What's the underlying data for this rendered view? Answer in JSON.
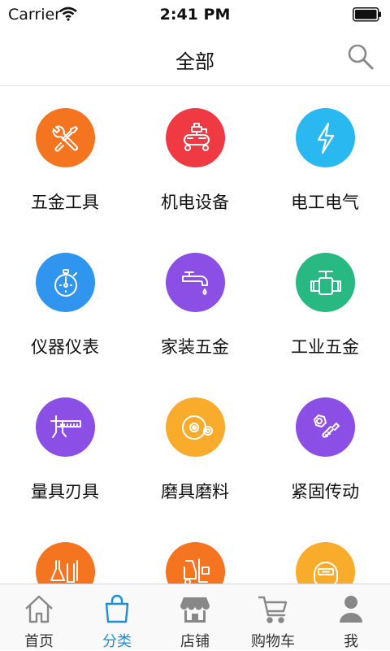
{
  "status_bar": {
    "carrier": "Carrier",
    "time": "2:41 PM"
  },
  "header": {
    "title": "全部"
  },
  "categories": [
    {
      "label": "五金工具",
      "icon": "wrench-screwdriver-icon",
      "color": "#f47420"
    },
    {
      "label": "机电设备",
      "icon": "air-compressor-icon",
      "color": "#ef3a44"
    },
    {
      "label": "电工电气",
      "icon": "lightning-bolt-icon",
      "color": "#2ab8f0"
    },
    {
      "label": "仪器仪表",
      "icon": "stopwatch-icon",
      "color": "#2f95ee"
    },
    {
      "label": "家装五金",
      "icon": "faucet-icon",
      "color": "#8c4fe6"
    },
    {
      "label": "工业五金",
      "icon": "valve-icon",
      "color": "#28b983"
    },
    {
      "label": "量具刃具",
      "icon": "caliper-icon",
      "color": "#8c4fe6"
    },
    {
      "label": "磨具磨料",
      "icon": "grinding-disc-icon",
      "color": "#f9ab2c"
    },
    {
      "label": "紧固传动",
      "icon": "bolt-nut-icon",
      "color": "#8c4fe6"
    },
    {
      "label": "",
      "icon": "lab-flask-icon",
      "color": "#f47420"
    },
    {
      "label": "",
      "icon": "forklift-icon",
      "color": "#f47420"
    },
    {
      "label": "",
      "icon": "welding-helmet-icon",
      "color": "#f9ab2c"
    }
  ],
  "tabbar": {
    "active_color": "#1a8fd8",
    "items": [
      {
        "label": "首页",
        "icon": "home-icon"
      },
      {
        "label": "分类",
        "icon": "shopping-bag-icon",
        "active": true
      },
      {
        "label": "店铺",
        "icon": "storefront-icon"
      },
      {
        "label": "购物车",
        "icon": "cart-icon"
      },
      {
        "label": "我",
        "icon": "person-icon"
      }
    ]
  }
}
